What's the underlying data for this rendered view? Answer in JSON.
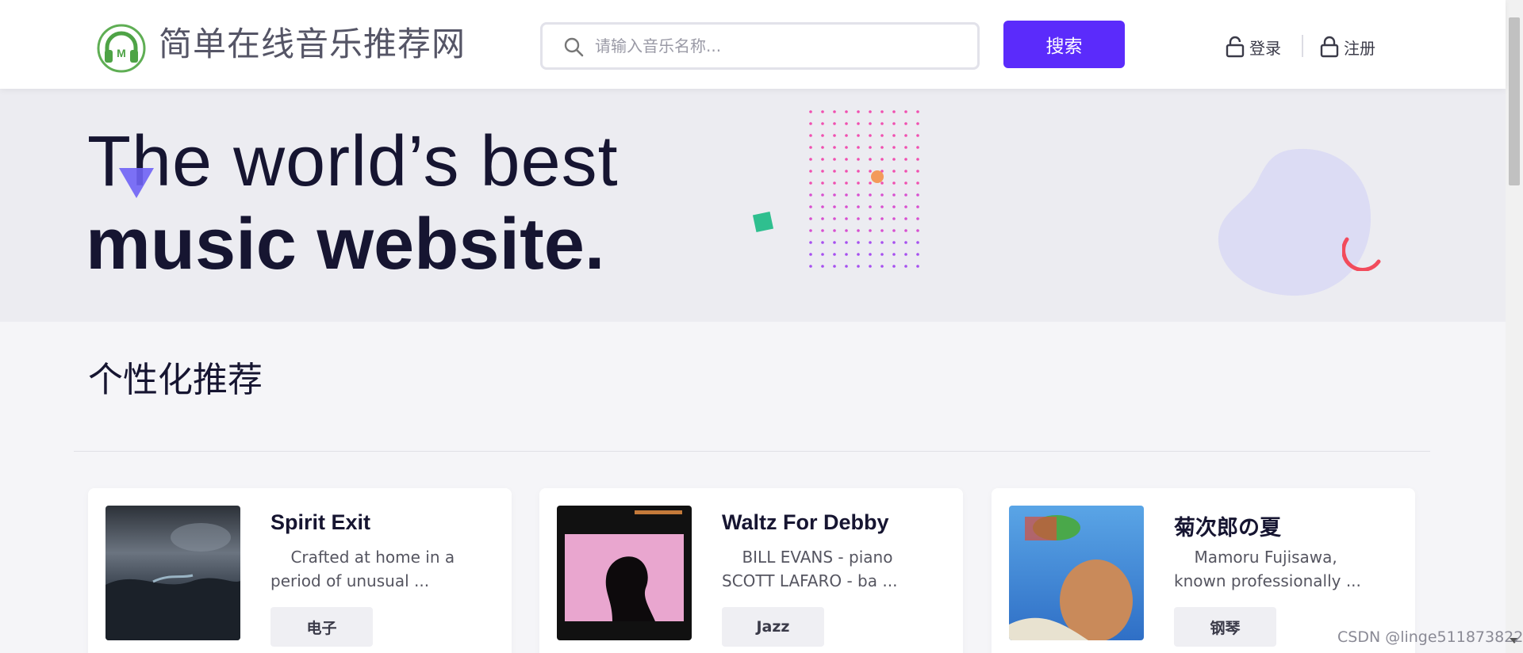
{
  "header": {
    "site_name": "简单在线音乐推荐网",
    "logo_letter": "M",
    "search_placeholder": "请输入音乐名称...",
    "search_button_label": "搜索",
    "login_label": "登录",
    "register_label": "注册"
  },
  "banner": {
    "line1": "The world’s best",
    "line2": "music website."
  },
  "section": {
    "title": "个性化推荐"
  },
  "cards": [
    {
      "title": "Spirit Exit",
      "desc": "Crafted at home in a period of unusual ...",
      "tag": "电子"
    },
    {
      "title": "Waltz For Debby",
      "desc": "BILL EVANS - piano SCOTT LAFARO - ba ...",
      "tag": "Jazz"
    },
    {
      "title": "菊次郎の夏",
      "desc": "Mamoru Fujisawa, known professionally ...",
      "tag": "钢琴"
    }
  ],
  "watermark": "CSDN @linge511873822",
  "colors": {
    "accent": "#5b2bfb",
    "banner_bg": "#ececf1",
    "logo_green": "#4caf50"
  }
}
